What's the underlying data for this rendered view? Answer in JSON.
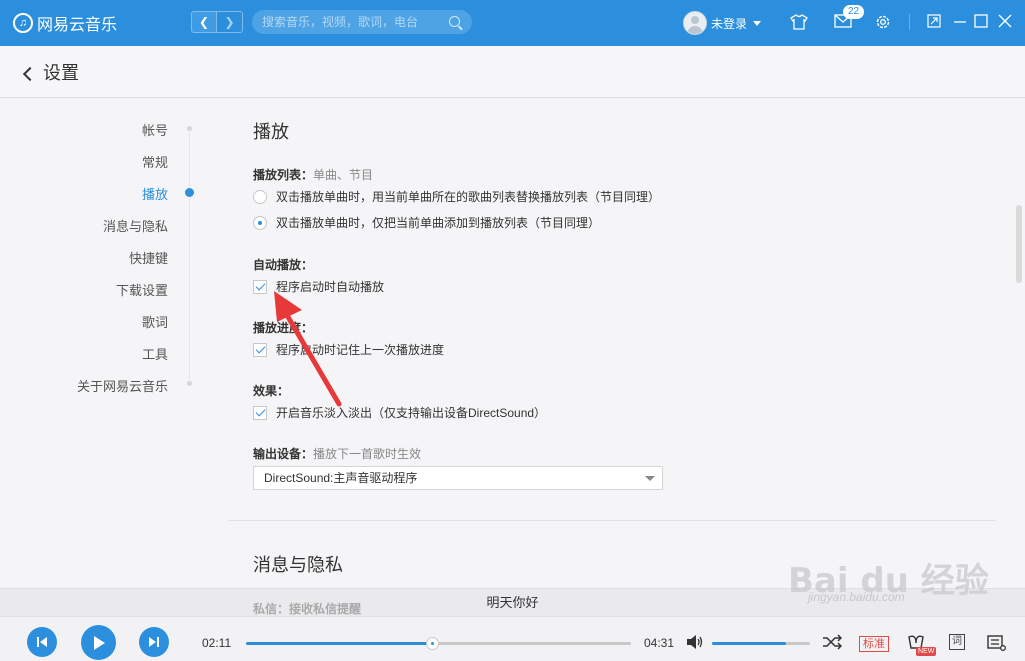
{
  "app": {
    "name": "网易云音乐"
  },
  "titlebar": {
    "search_placeholder": "搜索音乐，视频，歌词，电台",
    "user_label": "未登录",
    "message_count": "22"
  },
  "header": {
    "title": "设置"
  },
  "sidebar": {
    "items": [
      {
        "label": "帐号",
        "active": false
      },
      {
        "label": "常规",
        "active": false
      },
      {
        "label": "播放",
        "active": true
      },
      {
        "label": "消息与隐私",
        "active": false
      },
      {
        "label": "快捷键",
        "active": false
      },
      {
        "label": "下载设置",
        "active": false
      },
      {
        "label": "歌词",
        "active": false
      },
      {
        "label": "工具",
        "active": false
      },
      {
        "label": "关于网易云音乐",
        "active": false
      }
    ]
  },
  "playback": {
    "title": "播放",
    "playlist_label": "播放列表：",
    "playlist_note": "单曲、节目",
    "playlist_options": [
      {
        "label": "双击播放单曲时，用当前单曲所在的歌曲列表替换播放列表（节目同理）",
        "selected": false
      },
      {
        "label": "双击播放单曲时，仅把当前单曲添加到播放列表（节目同理）",
        "selected": true
      }
    ],
    "autoplay_label": "自动播放：",
    "autoplay_option": "程序启动时自动播放",
    "progress_label": "播放进度：",
    "progress_option": "程序启动时记住上一次播放进度",
    "effects_label": "效果：",
    "effects_option": "开启音乐淡入淡出（仅支持输出设备DirectSound）",
    "output_label": "输出设备：",
    "output_note": "播放下一首歌时生效",
    "output_value": "DirectSound:主声音驱动程序"
  },
  "privacy": {
    "title": "消息与隐私",
    "peek_label": "私信：",
    "peek_note": "接收私信提醒"
  },
  "player": {
    "now_playing": "明天你好",
    "elapsed": "02:11",
    "duration": "04:31",
    "progress_fraction": 0.4834,
    "volume_fraction": 0.75,
    "quality_label": "标准",
    "new_tag": "NEW",
    "lyric_label": "词"
  },
  "watermark": {
    "text": "Bai du 经验",
    "sub": "jingyan.baidu.com"
  },
  "colors": {
    "accent": "#2b8fde",
    "annotation": "#e8393a"
  }
}
